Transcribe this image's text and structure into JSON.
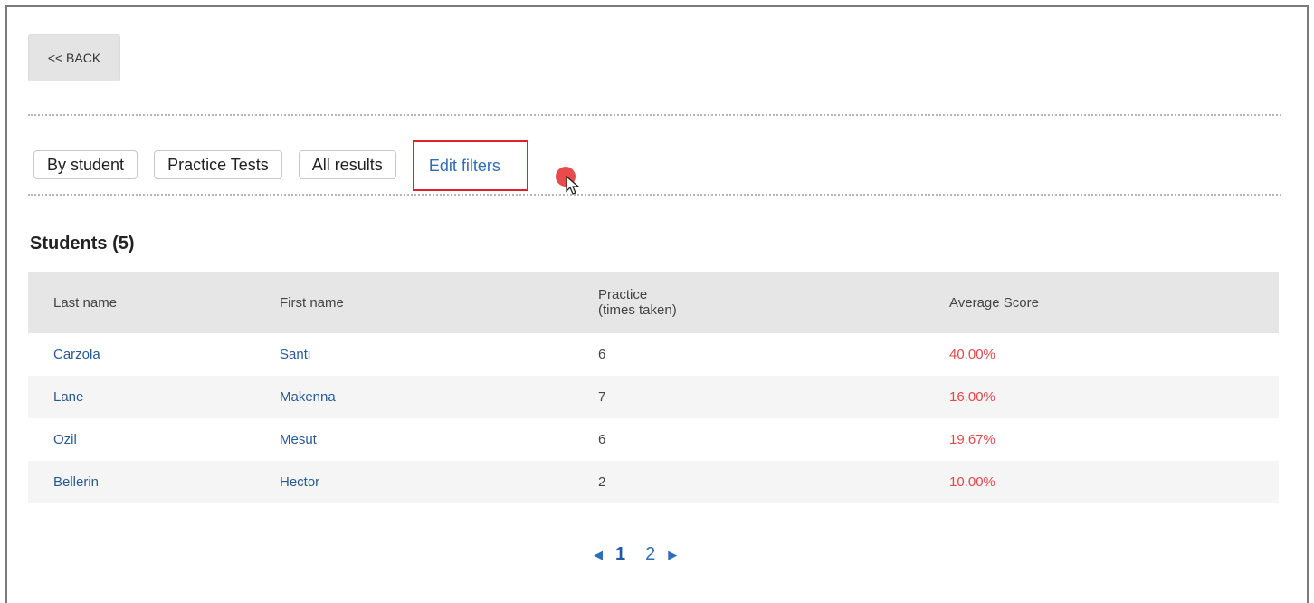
{
  "back_label": "<< BACK",
  "tabs": [
    {
      "label": "By student"
    },
    {
      "label": "Practice Tests"
    },
    {
      "label": "All results"
    },
    {
      "label": "Edit filters"
    }
  ],
  "heading": "Students (5)",
  "table": {
    "columns": [
      "Last name",
      "First name",
      "Practice",
      "(times taken)",
      "Average Score"
    ],
    "rows": [
      {
        "last": "Carzola",
        "first": "Santi",
        "practice": "6",
        "score": "40.00%"
      },
      {
        "last": "Lane",
        "first": "Makenna",
        "practice": "7",
        "score": "16.00%"
      },
      {
        "last": "Ozil",
        "first": "Mesut",
        "practice": "6",
        "score": "19.67%"
      },
      {
        "last": "Bellerin",
        "first": "Hector",
        "practice": "2",
        "score": "10.00%"
      }
    ]
  },
  "pagination": {
    "prev_icon": "caret-left-icon",
    "pages": [
      "1",
      "2"
    ],
    "current": "1",
    "next_icon": "caret-right-icon"
  },
  "colors": {
    "link": "#285a96",
    "score": "#e2484c",
    "highlight_border": "#e0202a"
  }
}
